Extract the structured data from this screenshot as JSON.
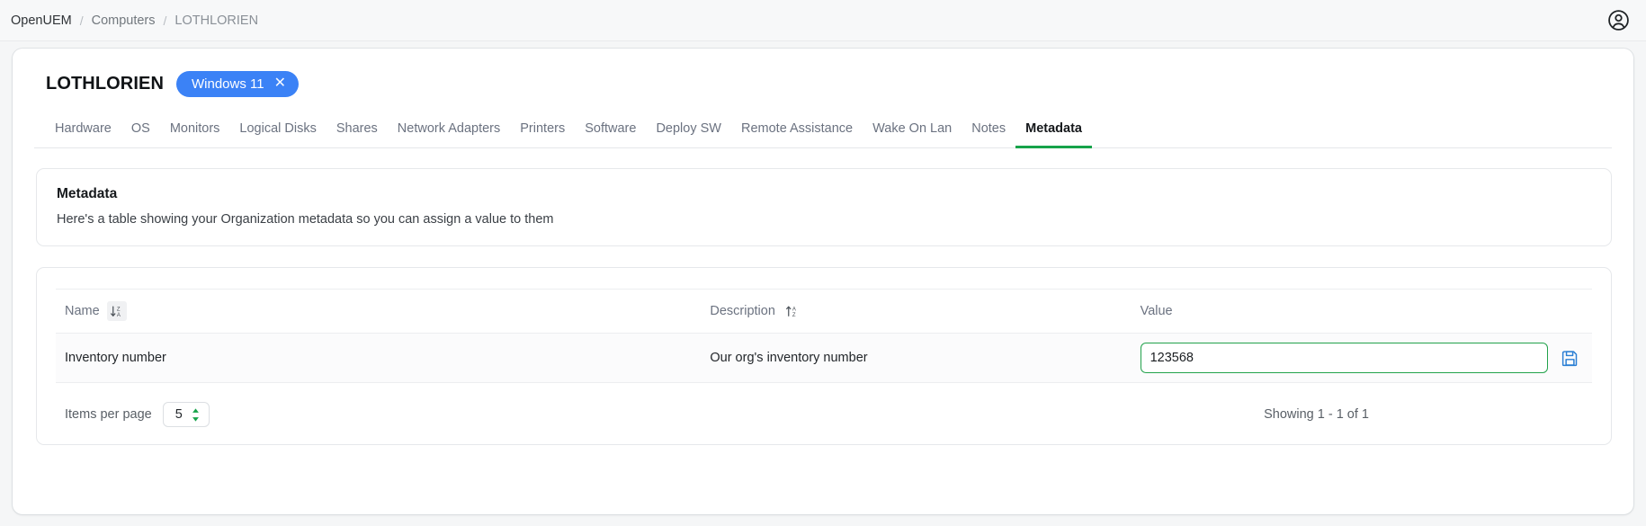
{
  "topbar": {
    "breadcrumb": [
      {
        "label": "OpenUEM",
        "type": "root"
      },
      {
        "label": "Computers",
        "type": "mid"
      },
      {
        "label": "LOTHLORIEN",
        "type": "current"
      }
    ],
    "separator": "/",
    "account_icon": "user-account-icon"
  },
  "header": {
    "device_name": "LOTHLORIEN",
    "os_badge": {
      "label": "Windows 11",
      "close_glyph": "✕",
      "color": "#3b82f6"
    }
  },
  "tabs": [
    {
      "label": "Hardware",
      "active": false
    },
    {
      "label": "OS",
      "active": false
    },
    {
      "label": "Monitors",
      "active": false
    },
    {
      "label": "Logical Disks",
      "active": false
    },
    {
      "label": "Shares",
      "active": false
    },
    {
      "label": "Network Adapters",
      "active": false
    },
    {
      "label": "Printers",
      "active": false
    },
    {
      "label": "Software",
      "active": false
    },
    {
      "label": "Deploy SW",
      "active": false
    },
    {
      "label": "Remote Assistance",
      "active": false
    },
    {
      "label": "Wake On Lan",
      "active": false
    },
    {
      "label": "Notes",
      "active": false
    },
    {
      "label": "Metadata",
      "active": true
    }
  ],
  "active_tab_color": "#16a34a",
  "info": {
    "title": "Metadata",
    "description": "Here's a table showing your Organization metadata so you can assign a value to them"
  },
  "table": {
    "columns": [
      {
        "label": "Name",
        "sort_icon": "sort-descending-za-icon",
        "sort_active": true
      },
      {
        "label": "Description",
        "sort_icon": "sort-ascending-az-icon",
        "sort_active": false
      },
      {
        "label": "Value",
        "sort_icon": null,
        "sort_active": false
      }
    ],
    "rows": [
      {
        "name": "Inventory number",
        "description": "Our org's inventory number",
        "value": "123568",
        "value_placeholder": "",
        "save_icon": "save-floppy-icon",
        "input_focused": true,
        "focus_border_color": "#22a24b"
      }
    ]
  },
  "footer": {
    "items_per_page_label": "Items per page",
    "items_per_page_value": "5",
    "showing_text": "Showing 1 - 1 of 1"
  }
}
